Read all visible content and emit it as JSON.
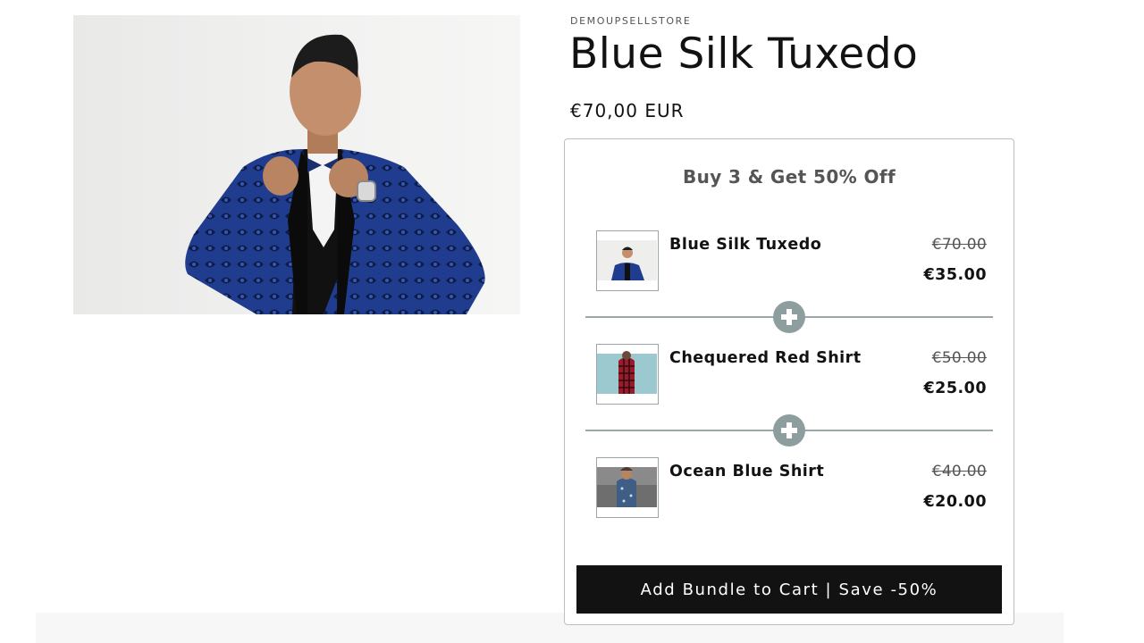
{
  "product": {
    "vendor": "DEMOUPSELLSTORE",
    "title": "Blue Silk Tuxedo",
    "price": "€70,00 EUR",
    "image_icon": "man-in-blue-tuxedo-photo"
  },
  "bundle": {
    "heading": "Buy 3 & Get 50% Off",
    "items": [
      {
        "name": "Blue Silk Tuxedo",
        "old_price": "€70.00",
        "new_price": "€35.00",
        "thumb_icon": "tuxedo-thumbnail"
      },
      {
        "name": "Chequered Red Shirt",
        "old_price": "€50.00",
        "new_price": "€25.00",
        "thumb_icon": "red-shirt-thumbnail"
      },
      {
        "name": "Ocean Blue Shirt",
        "old_price": "€40.00",
        "new_price": "€20.00",
        "thumb_icon": "blue-shirt-thumbnail"
      }
    ],
    "button_label": "Add Bundle to Cart | Save -50%"
  },
  "colors": {
    "button_bg": "#121212",
    "plus_circle": "#8e9e9f",
    "border": "#b8c1c3",
    "jacket": "#1f3c8f"
  }
}
